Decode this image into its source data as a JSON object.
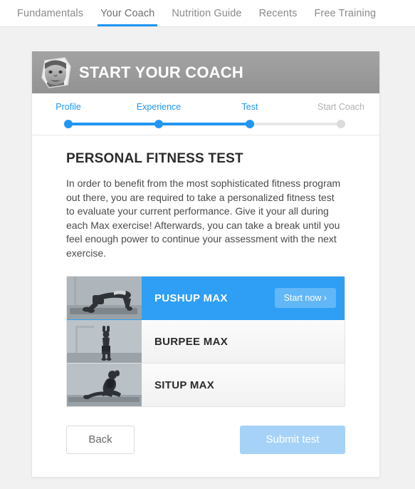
{
  "nav": {
    "tabs": [
      {
        "label": "Fundamentals",
        "active": false
      },
      {
        "label": "Your Coach",
        "active": true
      },
      {
        "label": "Nutrition Guide",
        "active": false
      },
      {
        "label": "Recents",
        "active": false
      },
      {
        "label": "Free Training",
        "active": false
      }
    ]
  },
  "header": {
    "title": "START YOUR COACH",
    "avatar_alt": "coach-avatar"
  },
  "stepper": {
    "steps": [
      {
        "label": "Profile",
        "state": "done"
      },
      {
        "label": "Experience",
        "state": "done"
      },
      {
        "label": "Test",
        "state": "done"
      },
      {
        "label": "Start Coach",
        "state": "todo"
      }
    ]
  },
  "main": {
    "section_title": "PERSONAL FITNESS TEST",
    "body_text": "In order to benefit from the most sophisticated fitness program out there, you are required to take a personalized fitness test to evaluate your current performance. Give it your all during each Max exercise! Afterwards, you can take a break until you feel enough power to continue your assessment with the next exercise."
  },
  "exercises": [
    {
      "name": "PUSHUP MAX",
      "active": true,
      "action_label": "Start now ›",
      "thumb": "pushup"
    },
    {
      "name": "BURPEE MAX",
      "active": false,
      "action_label": "",
      "thumb": "burpee"
    },
    {
      "name": "SITUP MAX",
      "active": false,
      "action_label": "",
      "thumb": "situp"
    }
  ],
  "footer": {
    "back_label": "Back",
    "submit_label": "Submit test"
  },
  "colors": {
    "accent": "#2196f3",
    "row_active": "#2e9ff5",
    "submit_disabled": "#a6d2f7",
    "header_grey": "#9a9a9a",
    "page_bg": "#f1f1f1"
  }
}
